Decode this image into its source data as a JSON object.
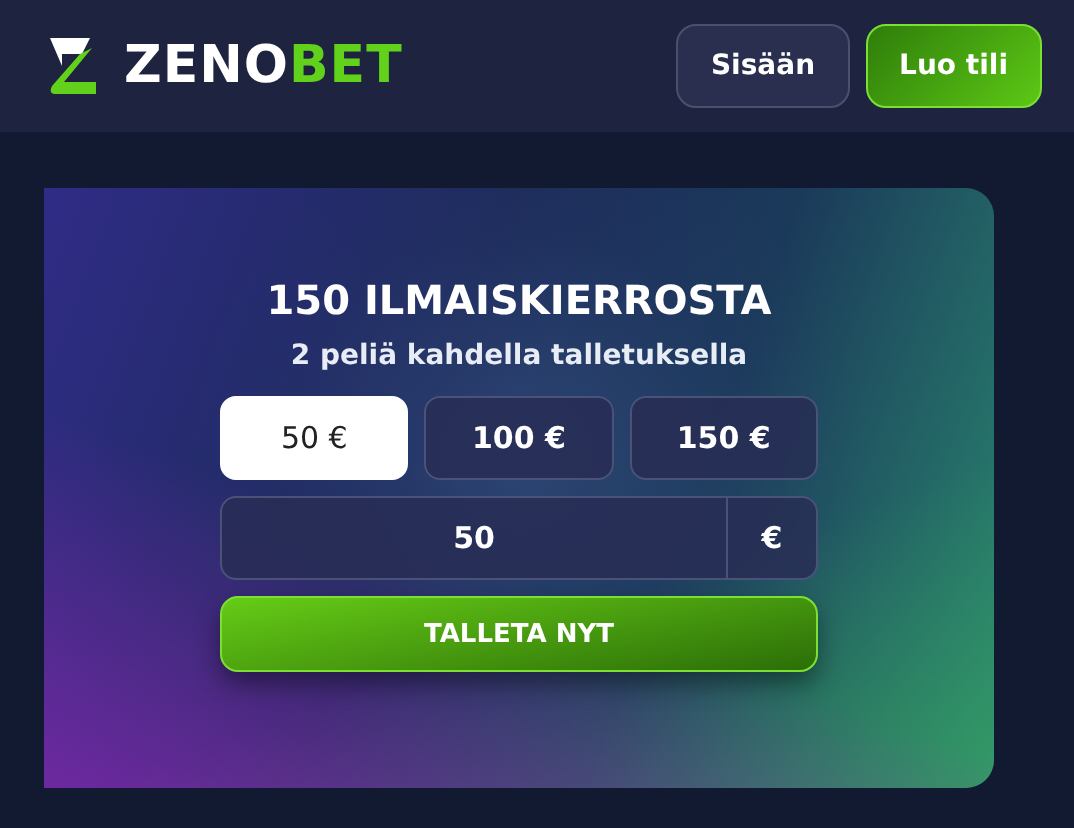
{
  "header": {
    "logo": {
      "part_1": "ZENO",
      "part_2": "BET"
    },
    "login_button": "Sisään",
    "register_button": "Luo tili"
  },
  "promo": {
    "title": "150 ILMAISKIERROSTA",
    "subtitle": "2 peliä kahdella talletuksella",
    "amounts": [
      {
        "label": "50 €",
        "selected": true
      },
      {
        "label": "100 €",
        "selected": false
      },
      {
        "label": "150 €",
        "selected": false
      }
    ],
    "amount_field": {
      "value": "50",
      "currency": "€"
    },
    "deposit_button": "TALLETA NYT"
  }
}
